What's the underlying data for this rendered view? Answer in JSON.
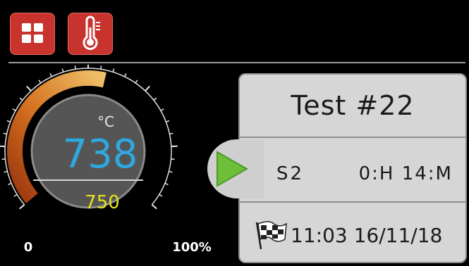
{
  "toolbar": {
    "buttons": [
      {
        "icon": "grid-icon"
      },
      {
        "icon": "thermometer-icon"
      }
    ],
    "button_color": "#c8332e"
  },
  "gauge": {
    "unit": "°C",
    "current_value": "738",
    "setpoint_value": "750",
    "min_label": "0",
    "max_label": "100%",
    "level_percent": 55,
    "current_color": "#2ea8e0",
    "setpoint_color": "#e6e21a"
  },
  "test_card": {
    "title": "Test #22",
    "stage": "S2",
    "duration": "0:H 14:M",
    "datetime": "11:03 16/11/18",
    "play_icon": "play-icon",
    "flag_icon": "checkered-flag-icon",
    "play_color": "#6dbf3a"
  }
}
